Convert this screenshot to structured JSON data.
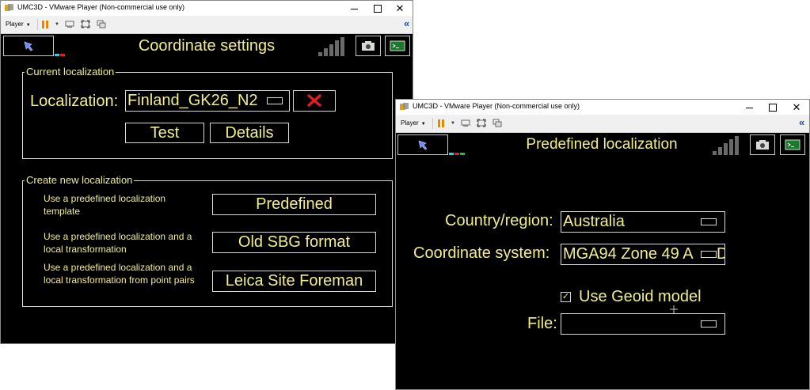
{
  "windows": [
    {
      "title": "UMC3D - VMware Player (Non-commercial use only)",
      "toolbar": {
        "player_label": "Player"
      },
      "screen_title": "Coordinate settings",
      "current_localization": {
        "legend": "Current localization",
        "label": "Localization:",
        "value": "Finland_GK26_N2",
        "clear_icon": "x-icon",
        "test_label": "Test",
        "details_label": "Details"
      },
      "create_new": {
        "legend": "Create new localization",
        "options": [
          {
            "description": "Use a predefined localization template",
            "button": "Predefined"
          },
          {
            "description": "Use a predefined localization and a local transformation",
            "button": "Old SBG format"
          },
          {
            "description": "Use a predefined localization and a local transformation from point pairs",
            "button": "Leica Site Foreman"
          }
        ]
      }
    },
    {
      "title": "UMC3D - VMware Player (Non-commercial use only)",
      "toolbar": {
        "player_label": "Player"
      },
      "screen_title": "Predefined localization",
      "form": {
        "country_label": "Country/region:",
        "country_value": "Australia",
        "coord_label": "Coordinate system:",
        "coord_value": "MGA94 Zone 49 A",
        "coord_value_suffix": "D",
        "geoid_label": "Use Geoid model",
        "geoid_checked": true,
        "file_label": "File:",
        "file_value": ""
      }
    }
  ],
  "colors": {
    "text": "#f2ee8a",
    "background": "#000000",
    "border": "#d8d8d8",
    "clear_icon": "#e02020"
  }
}
